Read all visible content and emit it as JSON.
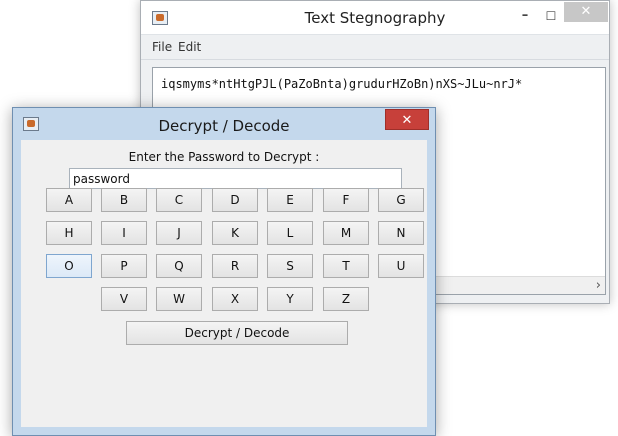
{
  "main_window": {
    "title": "Text Stegnography",
    "controls": {
      "minimize": "–",
      "maximize": "☐",
      "close": "✕"
    },
    "menu": {
      "file": "File",
      "edit": "Edit"
    },
    "text_area": {
      "content": "iqsmyms*ntHtgPJL(PaZoBnta)grudurHZoBn)nXS~JLu~nrJ*"
    },
    "scroll_arrow": "›"
  },
  "dialog": {
    "title": "Decrypt / Decode",
    "close": "✕",
    "prompt": "Enter the Password to Decrypt :",
    "password_value": "password",
    "keys": {
      "row1": [
        "A",
        "B",
        "C",
        "D",
        "E",
        "F",
        "G"
      ],
      "row2": [
        "H",
        "I",
        "J",
        "K",
        "L",
        "M",
        "N"
      ],
      "row3": [
        "O",
        "P",
        "Q",
        "R",
        "S",
        "T",
        "U"
      ],
      "row4": [
        "V",
        "W",
        "X",
        "Y",
        "Z"
      ]
    },
    "decrypt_button": "Decrypt / Decode"
  }
}
